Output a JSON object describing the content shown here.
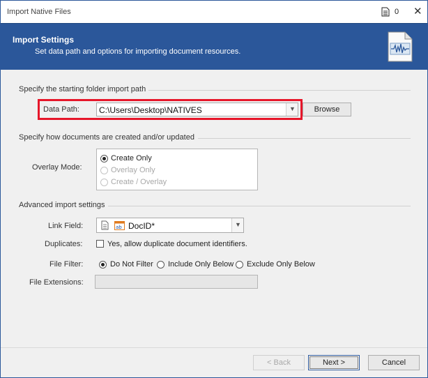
{
  "window": {
    "title": "Import Native Files",
    "doc_count": "0"
  },
  "header": {
    "title": "Import Settings",
    "subtitle": "Set data path and options for importing document resources."
  },
  "section_path": {
    "heading": "Specify the starting folder import path",
    "data_path_label": "Data Path:",
    "data_path_value": "C:\\Users\\Desktop\\NATIVES",
    "browse_label": "Browse"
  },
  "section_overlay": {
    "heading": "Specify how documents are created and/or updated",
    "overlay_label": "Overlay Mode:",
    "options": [
      {
        "label": "Create Only",
        "checked": true,
        "enabled": true
      },
      {
        "label": "Overlay Only",
        "checked": false,
        "enabled": false
      },
      {
        "label": "Create / Overlay",
        "checked": false,
        "enabled": false
      }
    ]
  },
  "section_advanced": {
    "heading": "Advanced import settings",
    "link_field_label": "Link Field:",
    "link_field_value": "DocID*",
    "link_field_type_icon": "ab-text-field-icon",
    "duplicates_label": "Duplicates:",
    "duplicates_checkbox_label": "Yes, allow duplicate document identifiers.",
    "duplicates_checked": false,
    "file_filter_label": "File Filter:",
    "file_filter_options": [
      {
        "label": "Do Not Filter",
        "checked": true
      },
      {
        "label": "Include Only Below",
        "checked": false
      },
      {
        "label": "Exclude Only Below",
        "checked": false
      }
    ],
    "file_extensions_label": "File Extensions:",
    "file_extensions_value": ""
  },
  "footer": {
    "back_label": "< Back",
    "next_label": "Next >",
    "cancel_label": "Cancel"
  },
  "colors": {
    "header_bg": "#2b579a",
    "highlight": "#e6162a"
  }
}
